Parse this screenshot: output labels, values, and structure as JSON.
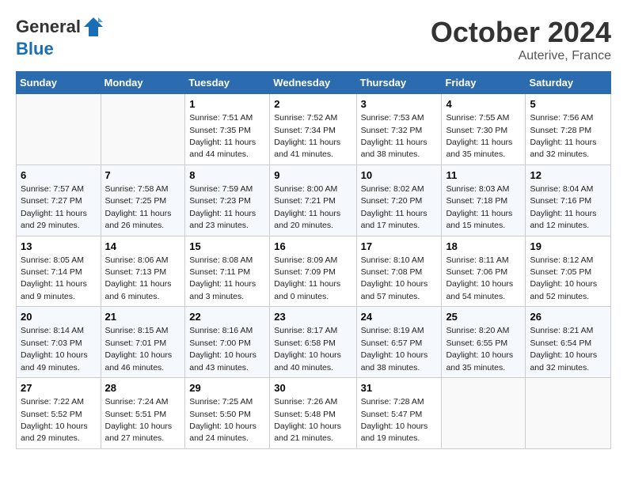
{
  "header": {
    "logo_line1": "General",
    "logo_line2": "Blue",
    "month": "October 2024",
    "location": "Auterive, France"
  },
  "weekdays": [
    "Sunday",
    "Monday",
    "Tuesday",
    "Wednesday",
    "Thursday",
    "Friday",
    "Saturday"
  ],
  "weeks": [
    [
      {
        "day": "",
        "info": ""
      },
      {
        "day": "",
        "info": ""
      },
      {
        "day": "1",
        "info": "Sunrise: 7:51 AM\nSunset: 7:35 PM\nDaylight: 11 hours and 44 minutes."
      },
      {
        "day": "2",
        "info": "Sunrise: 7:52 AM\nSunset: 7:34 PM\nDaylight: 11 hours and 41 minutes."
      },
      {
        "day": "3",
        "info": "Sunrise: 7:53 AM\nSunset: 7:32 PM\nDaylight: 11 hours and 38 minutes."
      },
      {
        "day": "4",
        "info": "Sunrise: 7:55 AM\nSunset: 7:30 PM\nDaylight: 11 hours and 35 minutes."
      },
      {
        "day": "5",
        "info": "Sunrise: 7:56 AM\nSunset: 7:28 PM\nDaylight: 11 hours and 32 minutes."
      }
    ],
    [
      {
        "day": "6",
        "info": "Sunrise: 7:57 AM\nSunset: 7:27 PM\nDaylight: 11 hours and 29 minutes."
      },
      {
        "day": "7",
        "info": "Sunrise: 7:58 AM\nSunset: 7:25 PM\nDaylight: 11 hours and 26 minutes."
      },
      {
        "day": "8",
        "info": "Sunrise: 7:59 AM\nSunset: 7:23 PM\nDaylight: 11 hours and 23 minutes."
      },
      {
        "day": "9",
        "info": "Sunrise: 8:00 AM\nSunset: 7:21 PM\nDaylight: 11 hours and 20 minutes."
      },
      {
        "day": "10",
        "info": "Sunrise: 8:02 AM\nSunset: 7:20 PM\nDaylight: 11 hours and 17 minutes."
      },
      {
        "day": "11",
        "info": "Sunrise: 8:03 AM\nSunset: 7:18 PM\nDaylight: 11 hours and 15 minutes."
      },
      {
        "day": "12",
        "info": "Sunrise: 8:04 AM\nSunset: 7:16 PM\nDaylight: 11 hours and 12 minutes."
      }
    ],
    [
      {
        "day": "13",
        "info": "Sunrise: 8:05 AM\nSunset: 7:14 PM\nDaylight: 11 hours and 9 minutes."
      },
      {
        "day": "14",
        "info": "Sunrise: 8:06 AM\nSunset: 7:13 PM\nDaylight: 11 hours and 6 minutes."
      },
      {
        "day": "15",
        "info": "Sunrise: 8:08 AM\nSunset: 7:11 PM\nDaylight: 11 hours and 3 minutes."
      },
      {
        "day": "16",
        "info": "Sunrise: 8:09 AM\nSunset: 7:09 PM\nDaylight: 11 hours and 0 minutes."
      },
      {
        "day": "17",
        "info": "Sunrise: 8:10 AM\nSunset: 7:08 PM\nDaylight: 10 hours and 57 minutes."
      },
      {
        "day": "18",
        "info": "Sunrise: 8:11 AM\nSunset: 7:06 PM\nDaylight: 10 hours and 54 minutes."
      },
      {
        "day": "19",
        "info": "Sunrise: 8:12 AM\nSunset: 7:05 PM\nDaylight: 10 hours and 52 minutes."
      }
    ],
    [
      {
        "day": "20",
        "info": "Sunrise: 8:14 AM\nSunset: 7:03 PM\nDaylight: 10 hours and 49 minutes."
      },
      {
        "day": "21",
        "info": "Sunrise: 8:15 AM\nSunset: 7:01 PM\nDaylight: 10 hours and 46 minutes."
      },
      {
        "day": "22",
        "info": "Sunrise: 8:16 AM\nSunset: 7:00 PM\nDaylight: 10 hours and 43 minutes."
      },
      {
        "day": "23",
        "info": "Sunrise: 8:17 AM\nSunset: 6:58 PM\nDaylight: 10 hours and 40 minutes."
      },
      {
        "day": "24",
        "info": "Sunrise: 8:19 AM\nSunset: 6:57 PM\nDaylight: 10 hours and 38 minutes."
      },
      {
        "day": "25",
        "info": "Sunrise: 8:20 AM\nSunset: 6:55 PM\nDaylight: 10 hours and 35 minutes."
      },
      {
        "day": "26",
        "info": "Sunrise: 8:21 AM\nSunset: 6:54 PM\nDaylight: 10 hours and 32 minutes."
      }
    ],
    [
      {
        "day": "27",
        "info": "Sunrise: 7:22 AM\nSunset: 5:52 PM\nDaylight: 10 hours and 29 minutes."
      },
      {
        "day": "28",
        "info": "Sunrise: 7:24 AM\nSunset: 5:51 PM\nDaylight: 10 hours and 27 minutes."
      },
      {
        "day": "29",
        "info": "Sunrise: 7:25 AM\nSunset: 5:50 PM\nDaylight: 10 hours and 24 minutes."
      },
      {
        "day": "30",
        "info": "Sunrise: 7:26 AM\nSunset: 5:48 PM\nDaylight: 10 hours and 21 minutes."
      },
      {
        "day": "31",
        "info": "Sunrise: 7:28 AM\nSunset: 5:47 PM\nDaylight: 10 hours and 19 minutes."
      },
      {
        "day": "",
        "info": ""
      },
      {
        "day": "",
        "info": ""
      }
    ]
  ]
}
